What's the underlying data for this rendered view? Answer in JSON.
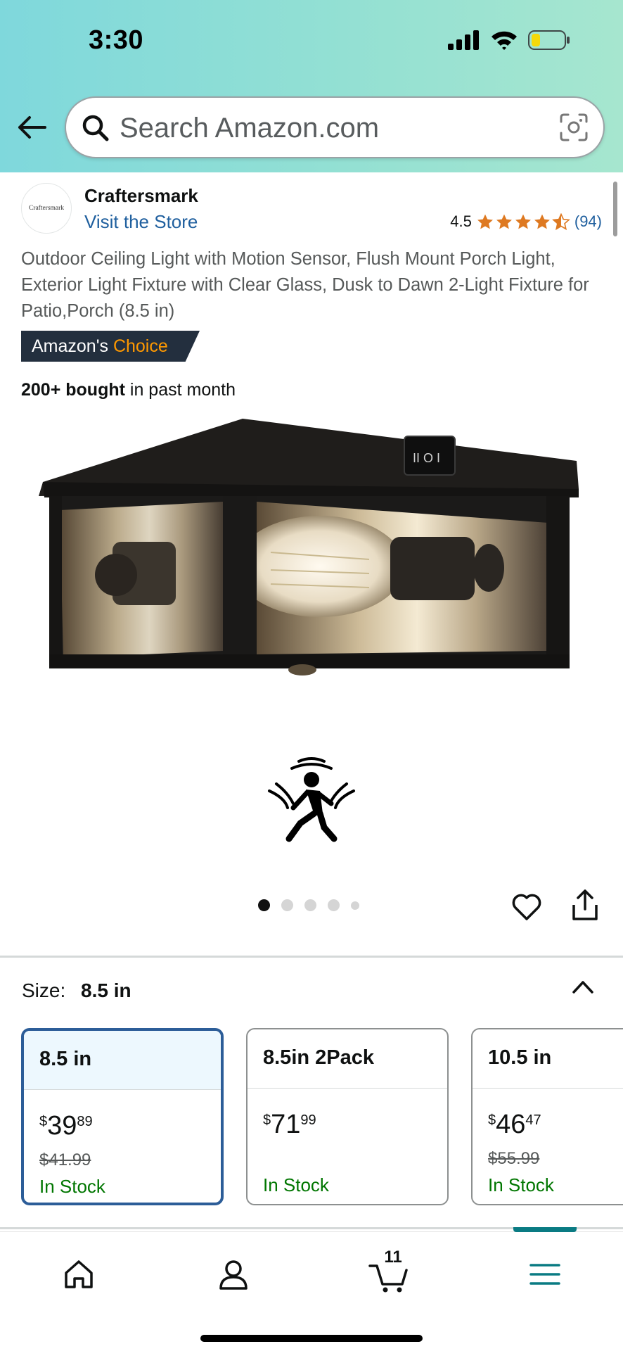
{
  "status_bar": {
    "time": "3:30"
  },
  "search": {
    "placeholder": "Search Amazon.com"
  },
  "seller": {
    "logo_text": "Craftersmark",
    "name": "Craftersmark",
    "store_link": "Visit the Store",
    "rating": "4.5",
    "review_count": "(94)",
    "stars_value": 4.5
  },
  "product": {
    "title": "Outdoor Ceiling Light with Motion Sensor, Flush Mount Porch Light, Exterior Light Fixture with Clear Glass, Dusk to Dawn 2-Light Fixture for Patio,Porch (8.5 in)",
    "badge_prefix": "Amazon's",
    "badge_highlight": "Choice",
    "bought_strong": "200+ bought",
    "bought_rest": "in past month",
    "image_count": 5,
    "active_image_index": 0
  },
  "size": {
    "label": "Size:",
    "selected": "8.5 in",
    "options": [
      {
        "name": "8.5 in",
        "currency": "$",
        "whole": "39",
        "fraction": "89",
        "old_price": "$41.99",
        "stock": "In Stock"
      },
      {
        "name": "8.5in 2Pack",
        "currency": "$",
        "whole": "71",
        "fraction": "99",
        "old_price": "",
        "stock": "In Stock"
      },
      {
        "name": "10.5 in",
        "currency": "$",
        "whole": "46",
        "fraction": "47",
        "old_price": "$55.99",
        "stock": "In Stock"
      }
    ]
  },
  "bottom_nav": {
    "cart_count": "11",
    "active": "menu"
  },
  "colors": {
    "accent_teal": "#0a7b83",
    "link_blue": "#1f5f9e",
    "star_orange": "#de7921",
    "badge_navy": "#232f3e",
    "choice_orange": "#ff9900",
    "in_stock_green": "#007600",
    "selected_border": "#2c5d98"
  }
}
